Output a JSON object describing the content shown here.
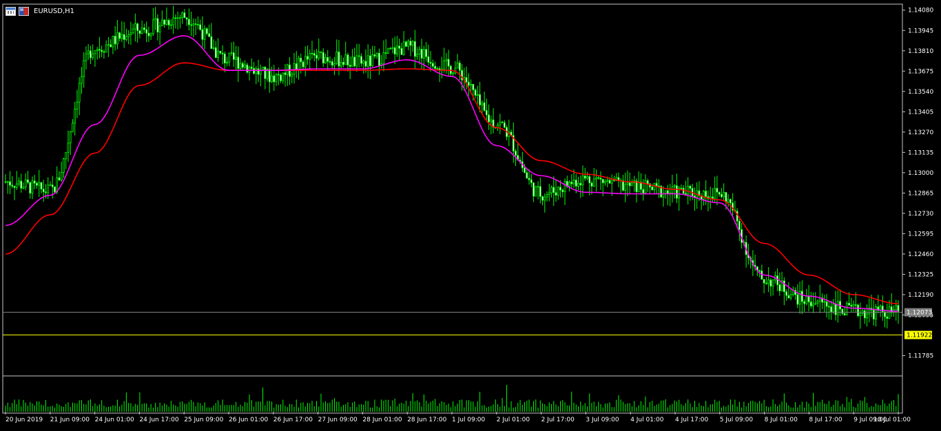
{
  "chart_header": {
    "symbol_title": "EURUSD,H1",
    "icons": [
      "chart-bars-icon",
      "currency-flag-icon"
    ]
  },
  "colors": {
    "background": "#000000",
    "candle": "#00ff00",
    "ma_fast": "#ff00ff",
    "ma_slow": "#ff0000",
    "bid_line": "#808080",
    "horizontal_level": "#ffff00",
    "volume": "#00ff00"
  },
  "chart_data": {
    "type": "line",
    "title": "EURUSD,H1",
    "xlabel": "",
    "ylabel": "",
    "ylim": [
      1.1165,
      1.1412
    ],
    "y_ticks": [
      "1.14080",
      "1.13945",
      "1.13810",
      "1.13675",
      "1.13540",
      "1.13405",
      "1.13270",
      "1.13135",
      "1.13000",
      "1.12865",
      "1.12730",
      "1.12595",
      "1.12460",
      "1.12325",
      "1.12190",
      "1.12055",
      "1.11785"
    ],
    "x_tick_labels": [
      "20 Jun 2019",
      "21 Jun 09:00",
      "24 Jun 01:00",
      "24 Jun 17:00",
      "25 Jun 09:00",
      "26 Jun 01:00",
      "26 Jun 17:00",
      "27 Jun 09:00",
      "28 Jun 01:00",
      "28 Jun 17:00",
      "1 Jul 09:00",
      "2 Jul 01:00",
      "2 Jul 17:00",
      "3 Jul 09:00",
      "4 Jul 01:00",
      "4 Jul 17:00",
      "5 Jul 09:00",
      "8 Jul 01:00",
      "8 Jul 17:00",
      "9 Jul 09:00",
      "10 Jul 01:00"
    ],
    "x_tick_count": 21,
    "current_price_label": "1.12073",
    "current_price": 1.12073,
    "level_label": "1.11922",
    "level_price": 1.11922,
    "series": [
      {
        "kind": "price",
        "x": [
          0,
          0.05,
          0.1,
          0.15,
          0.2,
          0.25,
          0.3,
          0.35,
          0.4,
          0.45,
          0.5,
          0.55,
          0.6,
          0.65,
          0.7,
          0.75,
          0.8,
          0.85,
          0.9,
          0.95,
          1.0
        ],
        "values": [
          1.1294,
          1.1288,
          1.1383,
          1.1395,
          1.1404,
          1.1375,
          1.1364,
          1.1377,
          1.1373,
          1.1383,
          1.137,
          1.1333,
          1.1286,
          1.1296,
          1.1291,
          1.1287,
          1.1286,
          1.1229,
          1.1215,
          1.1208,
          1.1207
        ]
      },
      {
        "kind": "ma_fast",
        "x": [
          0,
          0.05,
          0.1,
          0.15,
          0.2,
          0.25,
          0.3,
          0.35,
          0.4,
          0.45,
          0.5,
          0.55,
          0.6,
          0.65,
          0.7,
          0.75,
          0.8,
          0.85,
          0.9,
          0.95,
          1.0
        ],
        "values": [
          1.1265,
          1.1285,
          1.1332,
          1.1378,
          1.1391,
          1.1368,
          1.1368,
          1.1369,
          1.1369,
          1.1375,
          1.1364,
          1.1318,
          1.1298,
          1.1287,
          1.1286,
          1.1286,
          1.128,
          1.1232,
          1.1218,
          1.121,
          1.1208
        ]
      },
      {
        "kind": "ma_slow",
        "x": [
          0,
          0.05,
          0.1,
          0.15,
          0.2,
          0.25,
          0.3,
          0.35,
          0.4,
          0.45,
          0.5,
          0.55,
          0.6,
          0.65,
          0.7,
          0.75,
          0.8,
          0.85,
          0.9,
          0.95,
          1.0
        ],
        "values": [
          1.1246,
          1.1272,
          1.1313,
          1.1358,
          1.1373,
          1.1368,
          1.1368,
          1.1368,
          1.1368,
          1.1369,
          1.1368,
          1.133,
          1.1308,
          1.1299,
          1.1294,
          1.1289,
          1.1282,
          1.1253,
          1.1232,
          1.1219,
          1.1213
        ]
      }
    ]
  }
}
